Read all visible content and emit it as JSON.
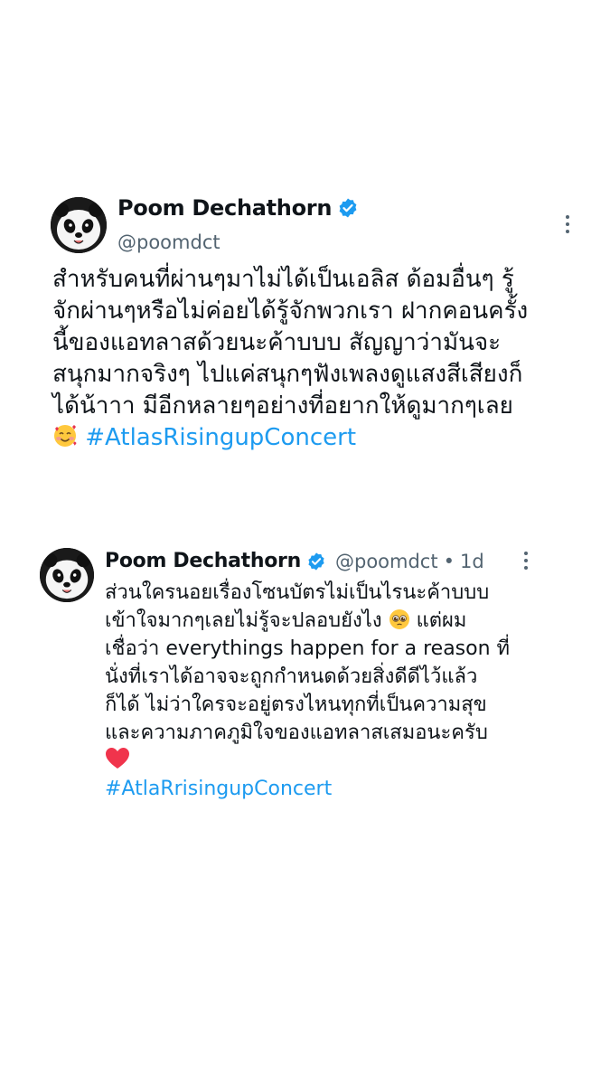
{
  "main_tweet": {
    "display_name": "Poom Dechathorn",
    "handle": "@poomdct",
    "avatar_icon": "panda-avatar-icon",
    "verified_icon": "verified-badge-icon",
    "body_text": "สำหรับคนที่ผ่านๆมาไม่ได้เป็นเอลิส ด้อมอื่นๆ รู้\nจักผ่านๆหรือไม่ค่อยได้รู้จักพวกเรา ฝากคอนครั้ง\nนี้ของแอทลาสด้วยนะค้าบบบ  สัญญาว่ามันจะ\nสนุกมากจริงๆ ไปแค่สนุกๆฟังเพลงดูแสงสีเสียงก็\nได้น้าาา มีอีกหลายๆอย่างที่อยากให้ดูมากๆเลย",
    "emoji": "smiling-face-with-hearts",
    "hashtag": "#AtlasRisingupConcert"
  },
  "reply_tweet": {
    "display_name": "Poom Dechathorn",
    "handle": "@poomdct",
    "separator": "•",
    "time": "1d",
    "avatar_icon": "panda-avatar-icon",
    "verified_icon": "verified-badge-icon",
    "body_before_emoji": "ส่วนใครนอยเรื่องโซนบัตรไม่เป็นไรนะค้าบบบ\nเข้าใจมากๆเลยไม่รู้จะปลอบยังไง ",
    "body_emoji": "pleading-face",
    "body_after_emoji": " แต่ผม\nเชื่อว่า everythings happen for a reason ที่\nนั่งที่เราได้อาจจะถูกกำหนดด้วยสิ่งดีดีไว้แล้ว\nก็ได้ ไม่ว่าใครจะอยู่ตรงไหนทุกที่เป็นความสุข\nและความภาคภูมิใจของแอทลาสเสมอนะครับ",
    "end_emoji": "red-heart",
    "hashtag": "#AtlaRrisingupConcert"
  },
  "colors": {
    "link": "#1d9bf0",
    "secondary_text": "#536471",
    "verified": "#1d9bf0"
  }
}
